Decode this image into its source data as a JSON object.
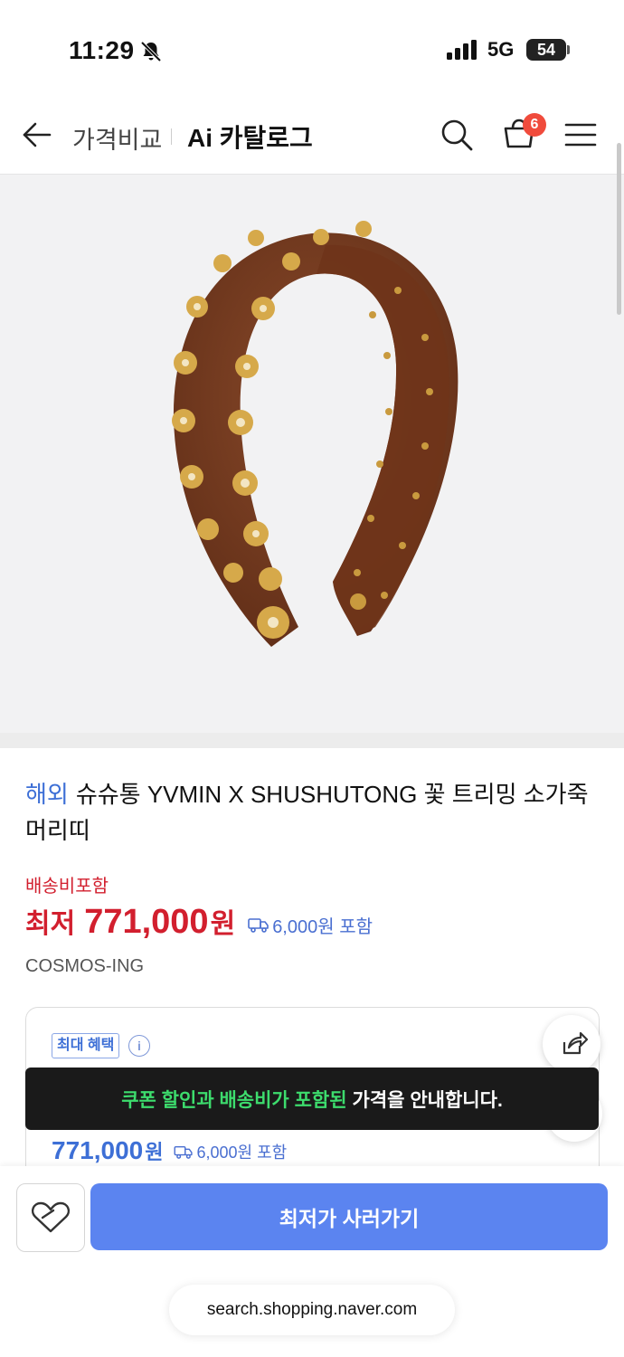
{
  "status_bar": {
    "time": "11:29",
    "network": "5G",
    "battery": "54"
  },
  "nav": {
    "compare_label": "가격비교",
    "catalog_label": "Ai 카탈로그",
    "cart_count": "6"
  },
  "product": {
    "overseas_label": "해외",
    "title": "슈슈통 YVMIN X SHUSHUTONG 꽃 트리밍 소가죽 머리띠",
    "shipping_included": "배송비포함",
    "lowest_label": "최저",
    "price": "771,000",
    "price_unit": "원",
    "shipping_fee": "6,000원 포함",
    "seller": "COSMOS-ING"
  },
  "benefit_card": {
    "badge": "최대 혜택",
    "info_icon": "i",
    "price": "771,000",
    "price_unit": "원",
    "shipping_fee": "6,000원 포함"
  },
  "toast": {
    "highlight": "쿠폰 할인과 배송비가 포함된",
    "text": "가격을 안내합니다."
  },
  "bottom_bar": {
    "buy_label": "최저가 사러가기"
  },
  "browser": {
    "url": "search.shopping.naver.com"
  },
  "colors": {
    "accent_blue": "#5b84f0",
    "price_red": "#d21f2e",
    "badge_red": "#f04b3c",
    "toast_green": "#3ddc6d"
  },
  "icons": [
    "bell-slash-icon",
    "signal-icon",
    "back-arrow-icon",
    "search-icon",
    "shopping-bag-icon",
    "hamburger-menu-icon",
    "info-icon",
    "truck-icon",
    "share-icon",
    "heart-tag-icon"
  ]
}
